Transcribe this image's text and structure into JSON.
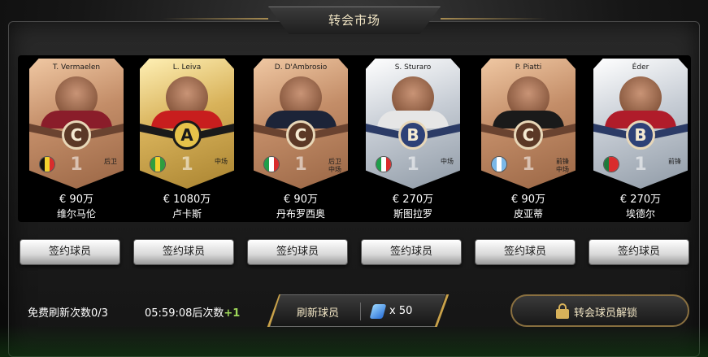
{
  "screen": {
    "title": "转会市场"
  },
  "players": [
    {
      "card_name": "T. Vermaelen",
      "grade": "C",
      "tier": "bronze",
      "rating": "1",
      "position": "后卫",
      "price": "€ 90万",
      "name": "维尔马伦",
      "flag": [
        "#111111",
        "#f2d12e",
        "#d92c2c"
      ],
      "shirt": "#8a1d2a"
    },
    {
      "card_name": "L. Leiva",
      "grade": "A",
      "tier": "gold",
      "rating": "1",
      "position": "中场",
      "price": "€ 1080万",
      "name": "卢卡斯",
      "flag": [
        "#2f9e3f",
        "#f2d12e",
        "#2f9e3f"
      ],
      "shirt": "#c81e1e"
    },
    {
      "card_name": "D. D'Ambrosio",
      "grade": "C",
      "tier": "bronze",
      "rating": "1",
      "position": "后卫\n中场",
      "price": "€ 90万",
      "name": "丹布罗西奥",
      "flag": [
        "#1e9e4a",
        "#ffffff",
        "#d92c2c"
      ],
      "shirt": "#1c2438"
    },
    {
      "card_name": "S. Sturaro",
      "grade": "B",
      "tier": "silver",
      "rating": "1",
      "position": "中场",
      "price": "€ 270万",
      "name": "斯图拉罗",
      "flag": [
        "#1e9e4a",
        "#ffffff",
        "#d92c2c"
      ],
      "shirt": "#e6e6e6"
    },
    {
      "card_name": "P. Piatti",
      "grade": "C",
      "tier": "bronze",
      "rating": "1",
      "position": "前锋\n中场",
      "price": "€ 90万",
      "name": "皮亚蒂",
      "flag": [
        "#7ab8e8",
        "#ffffff",
        "#7ab8e8"
      ],
      "shirt": "#1a1a1a"
    },
    {
      "card_name": "Éder",
      "grade": "B",
      "tier": "silver",
      "rating": "1",
      "position": "前锋",
      "price": "€ 270万",
      "name": "埃德尔",
      "flag": [
        "#1e7a3a",
        "#d92c2c",
        "#d92c2c"
      ],
      "shirt": "#b01c2a"
    }
  ],
  "sign_button_label": "签约球员",
  "footer": {
    "free_refresh": "免费刷新次数0/3",
    "timer": "05:59:08后次数",
    "timer_plus": "+1",
    "refresh_label": "刷新球员",
    "refresh_cost": "x 50",
    "unlock_label": "转会球员解锁"
  },
  "colors": {
    "accent_gold": "#c9a24a",
    "timer_plus": "#9fd85a"
  }
}
